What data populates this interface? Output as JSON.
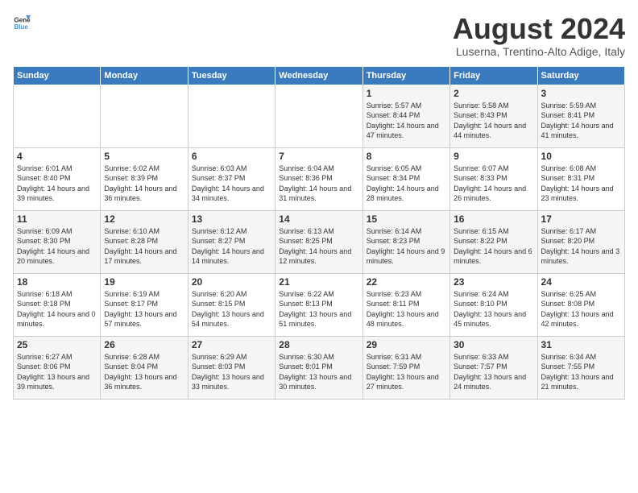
{
  "logo": {
    "general": "General",
    "blue": "Blue"
  },
  "title": "August 2024",
  "subtitle": "Luserna, Trentino-Alto Adige, Italy",
  "headers": [
    "Sunday",
    "Monday",
    "Tuesday",
    "Wednesday",
    "Thursday",
    "Friday",
    "Saturday"
  ],
  "weeks": [
    [
      {
        "day": "",
        "text": ""
      },
      {
        "day": "",
        "text": ""
      },
      {
        "day": "",
        "text": ""
      },
      {
        "day": "",
        "text": ""
      },
      {
        "day": "1",
        "text": "Sunrise: 5:57 AM\nSunset: 8:44 PM\nDaylight: 14 hours and 47 minutes."
      },
      {
        "day": "2",
        "text": "Sunrise: 5:58 AM\nSunset: 8:43 PM\nDaylight: 14 hours and 44 minutes."
      },
      {
        "day": "3",
        "text": "Sunrise: 5:59 AM\nSunset: 8:41 PM\nDaylight: 14 hours and 41 minutes."
      }
    ],
    [
      {
        "day": "4",
        "text": "Sunrise: 6:01 AM\nSunset: 8:40 PM\nDaylight: 14 hours and 39 minutes."
      },
      {
        "day": "5",
        "text": "Sunrise: 6:02 AM\nSunset: 8:39 PM\nDaylight: 14 hours and 36 minutes."
      },
      {
        "day": "6",
        "text": "Sunrise: 6:03 AM\nSunset: 8:37 PM\nDaylight: 14 hours and 34 minutes."
      },
      {
        "day": "7",
        "text": "Sunrise: 6:04 AM\nSunset: 8:36 PM\nDaylight: 14 hours and 31 minutes."
      },
      {
        "day": "8",
        "text": "Sunrise: 6:05 AM\nSunset: 8:34 PM\nDaylight: 14 hours and 28 minutes."
      },
      {
        "day": "9",
        "text": "Sunrise: 6:07 AM\nSunset: 8:33 PM\nDaylight: 14 hours and 26 minutes."
      },
      {
        "day": "10",
        "text": "Sunrise: 6:08 AM\nSunset: 8:31 PM\nDaylight: 14 hours and 23 minutes."
      }
    ],
    [
      {
        "day": "11",
        "text": "Sunrise: 6:09 AM\nSunset: 8:30 PM\nDaylight: 14 hours and 20 minutes."
      },
      {
        "day": "12",
        "text": "Sunrise: 6:10 AM\nSunset: 8:28 PM\nDaylight: 14 hours and 17 minutes."
      },
      {
        "day": "13",
        "text": "Sunrise: 6:12 AM\nSunset: 8:27 PM\nDaylight: 14 hours and 14 minutes."
      },
      {
        "day": "14",
        "text": "Sunrise: 6:13 AM\nSunset: 8:25 PM\nDaylight: 14 hours and 12 minutes."
      },
      {
        "day": "15",
        "text": "Sunrise: 6:14 AM\nSunset: 8:23 PM\nDaylight: 14 hours and 9 minutes."
      },
      {
        "day": "16",
        "text": "Sunrise: 6:15 AM\nSunset: 8:22 PM\nDaylight: 14 hours and 6 minutes."
      },
      {
        "day": "17",
        "text": "Sunrise: 6:17 AM\nSunset: 8:20 PM\nDaylight: 14 hours and 3 minutes."
      }
    ],
    [
      {
        "day": "18",
        "text": "Sunrise: 6:18 AM\nSunset: 8:18 PM\nDaylight: 14 hours and 0 minutes."
      },
      {
        "day": "19",
        "text": "Sunrise: 6:19 AM\nSunset: 8:17 PM\nDaylight: 13 hours and 57 minutes."
      },
      {
        "day": "20",
        "text": "Sunrise: 6:20 AM\nSunset: 8:15 PM\nDaylight: 13 hours and 54 minutes."
      },
      {
        "day": "21",
        "text": "Sunrise: 6:22 AM\nSunset: 8:13 PM\nDaylight: 13 hours and 51 minutes."
      },
      {
        "day": "22",
        "text": "Sunrise: 6:23 AM\nSunset: 8:11 PM\nDaylight: 13 hours and 48 minutes."
      },
      {
        "day": "23",
        "text": "Sunrise: 6:24 AM\nSunset: 8:10 PM\nDaylight: 13 hours and 45 minutes."
      },
      {
        "day": "24",
        "text": "Sunrise: 6:25 AM\nSunset: 8:08 PM\nDaylight: 13 hours and 42 minutes."
      }
    ],
    [
      {
        "day": "25",
        "text": "Sunrise: 6:27 AM\nSunset: 8:06 PM\nDaylight: 13 hours and 39 minutes."
      },
      {
        "day": "26",
        "text": "Sunrise: 6:28 AM\nSunset: 8:04 PM\nDaylight: 13 hours and 36 minutes."
      },
      {
        "day": "27",
        "text": "Sunrise: 6:29 AM\nSunset: 8:03 PM\nDaylight: 13 hours and 33 minutes."
      },
      {
        "day": "28",
        "text": "Sunrise: 6:30 AM\nSunset: 8:01 PM\nDaylight: 13 hours and 30 minutes."
      },
      {
        "day": "29",
        "text": "Sunrise: 6:31 AM\nSunset: 7:59 PM\nDaylight: 13 hours and 27 minutes."
      },
      {
        "day": "30",
        "text": "Sunrise: 6:33 AM\nSunset: 7:57 PM\nDaylight: 13 hours and 24 minutes."
      },
      {
        "day": "31",
        "text": "Sunrise: 6:34 AM\nSunset: 7:55 PM\nDaylight: 13 hours and 21 minutes."
      }
    ]
  ]
}
